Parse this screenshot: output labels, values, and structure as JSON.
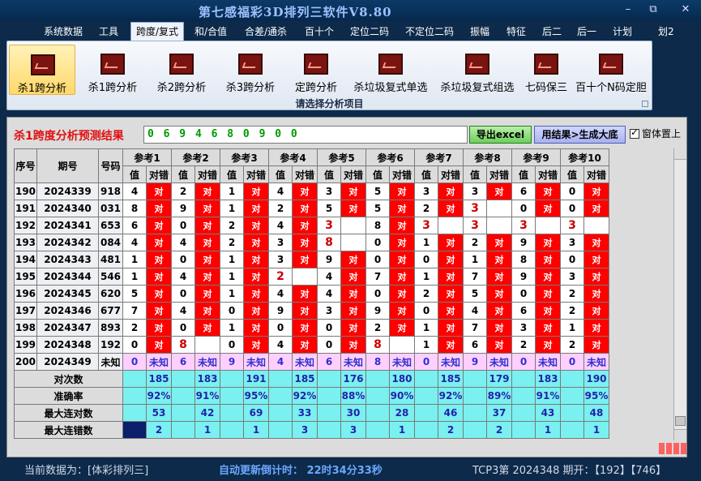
{
  "window": {
    "title": "第七感福彩3D排列三软件V8.80",
    "buttons": [
      "–",
      "⧉",
      "✕"
    ]
  },
  "menu": [
    {
      "label": "系统数据"
    },
    {
      "label": "工具"
    },
    {
      "label": "跨度/复式",
      "active": true
    },
    {
      "label": "和/合值"
    },
    {
      "label": "合差/通杀"
    },
    {
      "label": "百十个"
    },
    {
      "label": "定位二码"
    },
    {
      "label": "不定位二码"
    },
    {
      "label": "振幅"
    },
    {
      "label": "特征"
    },
    {
      "label": "后二"
    },
    {
      "label": "后一"
    },
    {
      "label": "计划"
    },
    {
      "label": "划2"
    }
  ],
  "ribbon": {
    "items": [
      {
        "label": "杀1跨分析",
        "icon": "chart-icon",
        "active": true
      },
      {
        "label": "杀1跨分析",
        "icon": "chart-icon"
      },
      {
        "label": "杀2跨分析",
        "icon": "chart-icon"
      },
      {
        "label": "杀3跨分析",
        "icon": "chart-icon"
      },
      {
        "label": "定跨分析",
        "icon": "chart-icon"
      },
      {
        "label": "杀垃圾复式单选",
        "icon": "chart-icon"
      },
      {
        "label": "杀垃圾复式组选",
        "icon": "chart-icon"
      },
      {
        "label": "七码保三",
        "icon": "chart-icon"
      },
      {
        "label": "百十个N码定胆",
        "icon": "chart-icon"
      }
    ],
    "caption": "请选择分析项目"
  },
  "panel": {
    "result_label": "杀1跨度分析预测结果",
    "result_value": "0 6 9 4 6 8 0 9 0 0",
    "export_button": "导出excel",
    "generate_button": "用结果>生成大底",
    "on_top_label": "窗体置上",
    "on_top_checked": true
  },
  "table": {
    "fixed_headers": [
      "序号",
      "期号",
      "号码"
    ],
    "ref_headers": [
      "参考1",
      "参考2",
      "参考3",
      "参考4",
      "参考5",
      "参考6",
      "参考7",
      "参考8",
      "参考9",
      "参考10"
    ],
    "sub_headers": [
      "值",
      "对错"
    ],
    "ok_text": "对",
    "rows": [
      {
        "seq": "190",
        "issue": "2024339",
        "num": "918",
        "cells": [
          [
            "4",
            "对"
          ],
          [
            "2",
            "对"
          ],
          [
            "1",
            "对"
          ],
          [
            "4",
            "对"
          ],
          [
            "3",
            "对"
          ],
          [
            "5",
            "对"
          ],
          [
            "3",
            "对"
          ],
          [
            "3",
            "对"
          ],
          [
            "6",
            "对"
          ],
          [
            "0",
            "对"
          ]
        ]
      },
      {
        "seq": "191",
        "issue": "2024340",
        "num": "031",
        "cells": [
          [
            "8",
            "对"
          ],
          [
            "9",
            "对"
          ],
          [
            "1",
            "对"
          ],
          [
            "2",
            "对"
          ],
          [
            "5",
            "对"
          ],
          [
            "5",
            "对"
          ],
          [
            "2",
            "对"
          ],
          [
            "3!",
            ""
          ],
          [
            "0",
            "对"
          ],
          [
            "0",
            "对"
          ]
        ]
      },
      {
        "seq": "192",
        "issue": "2024341",
        "num": "653",
        "cells": [
          [
            "6",
            "对"
          ],
          [
            "0",
            "对"
          ],
          [
            "2",
            "对"
          ],
          [
            "4",
            "对"
          ],
          [
            "3!",
            ""
          ],
          [
            "8",
            "对"
          ],
          [
            "3!",
            ""
          ],
          [
            "3!",
            ""
          ],
          [
            "3!",
            ""
          ],
          [
            "3!",
            ""
          ]
        ]
      },
      {
        "seq": "193",
        "issue": "2024342",
        "num": "084",
        "cells": [
          [
            "4",
            "对"
          ],
          [
            "4",
            "对"
          ],
          [
            "2",
            "对"
          ],
          [
            "3",
            "对"
          ],
          [
            "8!",
            ""
          ],
          [
            "0",
            "对"
          ],
          [
            "1",
            "对"
          ],
          [
            "2",
            "对"
          ],
          [
            "9",
            "对"
          ],
          [
            "3",
            "对"
          ]
        ]
      },
      {
        "seq": "194",
        "issue": "2024343",
        "num": "481",
        "cells": [
          [
            "1",
            "对"
          ],
          [
            "0",
            "对"
          ],
          [
            "1",
            "对"
          ],
          [
            "3",
            "对"
          ],
          [
            "9",
            "对"
          ],
          [
            "0",
            "对"
          ],
          [
            "0",
            "对"
          ],
          [
            "1",
            "对"
          ],
          [
            "8",
            "对"
          ],
          [
            "0",
            "对"
          ]
        ]
      },
      {
        "seq": "195",
        "issue": "2024344",
        "num": "546",
        "cells": [
          [
            "1",
            "对"
          ],
          [
            "4",
            "对"
          ],
          [
            "1",
            "对"
          ],
          [
            "2!",
            ""
          ],
          [
            "4",
            "对"
          ],
          [
            "7",
            "对"
          ],
          [
            "1",
            "对"
          ],
          [
            "7",
            "对"
          ],
          [
            "9",
            "对"
          ],
          [
            "3",
            "对"
          ]
        ]
      },
      {
        "seq": "196",
        "issue": "2024345",
        "num": "620",
        "cells": [
          [
            "5",
            "对"
          ],
          [
            "0",
            "对"
          ],
          [
            "1",
            "对"
          ],
          [
            "4",
            "对"
          ],
          [
            "4",
            "对"
          ],
          [
            "0",
            "对"
          ],
          [
            "2",
            "对"
          ],
          [
            "5",
            "对"
          ],
          [
            "0",
            "对"
          ],
          [
            "2",
            "对"
          ]
        ]
      },
      {
        "seq": "197",
        "issue": "2024346",
        "num": "677",
        "cells": [
          [
            "7",
            "对"
          ],
          [
            "4",
            "对"
          ],
          [
            "0",
            "对"
          ],
          [
            "9",
            "对"
          ],
          [
            "3",
            "对"
          ],
          [
            "9",
            "对"
          ],
          [
            "0",
            "对"
          ],
          [
            "4",
            "对"
          ],
          [
            "6",
            "对"
          ],
          [
            "2",
            "对"
          ]
        ]
      },
      {
        "seq": "198",
        "issue": "2024347",
        "num": "893",
        "cells": [
          [
            "2",
            "对"
          ],
          [
            "0",
            "对"
          ],
          [
            "1",
            "对"
          ],
          [
            "0",
            "对"
          ],
          [
            "0",
            "对"
          ],
          [
            "2",
            "对"
          ],
          [
            "1",
            "对"
          ],
          [
            "7",
            "对"
          ],
          [
            "3",
            "对"
          ],
          [
            "1",
            "对"
          ]
        ]
      },
      {
        "seq": "199",
        "issue": "2024348",
        "num": "192",
        "cells": [
          [
            "0",
            "对"
          ],
          [
            "8!",
            ""
          ],
          [
            "0",
            "对"
          ],
          [
            "4",
            "对"
          ],
          [
            "0",
            "对"
          ],
          [
            "8!",
            ""
          ],
          [
            "1",
            "对"
          ],
          [
            "6",
            "对"
          ],
          [
            "2",
            "对"
          ],
          [
            "2",
            "对"
          ]
        ]
      }
    ],
    "pending_row": {
      "seq": "200",
      "issue": "2024349",
      "num": "未知",
      "values": [
        "0",
        "6",
        "9",
        "4",
        "6",
        "8",
        "0",
        "9",
        "0",
        "0"
      ],
      "status": "未知"
    },
    "stats": [
      {
        "label": "对次数",
        "values": [
          "185",
          "183",
          "191",
          "185",
          "176",
          "180",
          "185",
          "179",
          "183",
          "190"
        ]
      },
      {
        "label": "准确率",
        "values": [
          "92%",
          "91%",
          "95%",
          "92%",
          "88%",
          "90%",
          "92%",
          "89%",
          "91%",
          "95%"
        ]
      },
      {
        "label": "最大连对数",
        "values": [
          "53",
          "42",
          "69",
          "33",
          "30",
          "28",
          "46",
          "37",
          "43",
          "48"
        ]
      },
      {
        "label": "最大连错数",
        "values": [
          "2",
          "1",
          "1",
          "3",
          "3",
          "1",
          "2",
          "2",
          "1",
          "1"
        ]
      }
    ]
  },
  "status": {
    "current": "当前数据为：[体彩排列三]",
    "countdown": "自动更新倒计时：  22时34分33秒",
    "tcp": "TCP3第 2024348 期开：【192】【746】"
  },
  "colors": {
    "ok": "#ff0000",
    "stat": "#7af0f0",
    "pending": "#ffd0ff",
    "accent": "#0b3a68"
  }
}
